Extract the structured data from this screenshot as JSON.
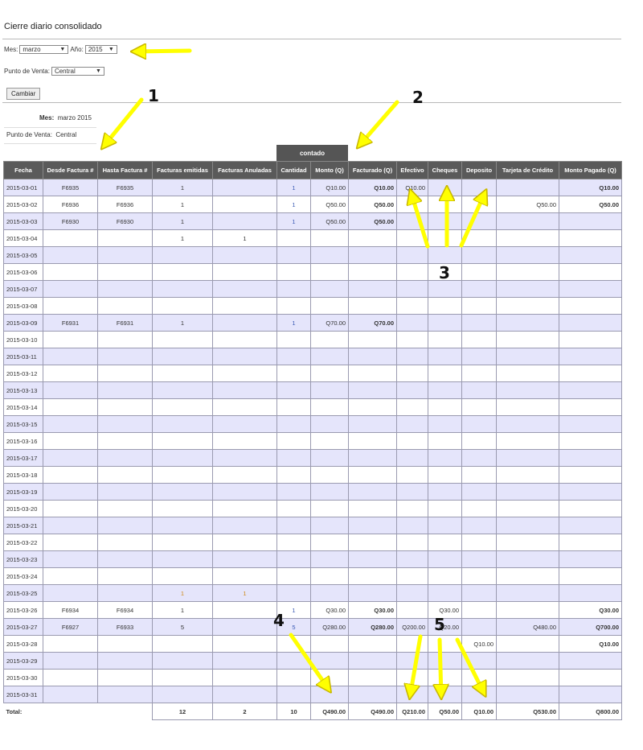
{
  "page": {
    "title": "Cierre diario consolidado"
  },
  "form": {
    "mes_label": "Mes:",
    "mes_value": "marzo",
    "anio_label": "Año:",
    "anio_value": "2015",
    "punto_label": "Punto de Venta:",
    "punto_value": "Central",
    "button_label": "Cambiar"
  },
  "info": {
    "mes_label": "Mes:",
    "mes_value": "marzo 2015",
    "punto_label": "Punto de Venta:",
    "punto_value": "Central"
  },
  "group_header": "contado",
  "columns": [
    "Fecha",
    "Desde Factura #",
    "Hasta Factura #",
    "Facturas emitidas",
    "Facturas Anuladas",
    "Cantidad",
    "Monto (Q)",
    "Facturado (Q)",
    "Efectivo",
    "Cheques",
    "Deposito",
    "Tarjeta de Crédito",
    "Monto Pagado (Q)"
  ],
  "rows": [
    [
      "2015-03-01",
      "F6935",
      "F6935",
      "1",
      "",
      "1",
      "Q10.00",
      "Q10.00",
      "Q10.00",
      "",
      "",
      "",
      "Q10.00"
    ],
    [
      "2015-03-02",
      "F6936",
      "F6936",
      "1",
      "",
      "1",
      "Q50.00",
      "Q50.00",
      "",
      "",
      "",
      "Q50.00",
      "Q50.00"
    ],
    [
      "2015-03-03",
      "F6930",
      "F6930",
      "1",
      "",
      "1",
      "Q50.00",
      "Q50.00",
      "",
      "",
      "",
      "",
      ""
    ],
    [
      "2015-03-04",
      "",
      "",
      "1",
      "1",
      "",
      "",
      "",
      "",
      "",
      "",
      "",
      ""
    ],
    [
      "2015-03-05",
      "",
      "",
      "",
      "",
      "",
      "",
      "",
      "",
      "",
      "",
      "",
      ""
    ],
    [
      "2015-03-06",
      "",
      "",
      "",
      "",
      "",
      "",
      "",
      "",
      "",
      "",
      "",
      ""
    ],
    [
      "2015-03-07",
      "",
      "",
      "",
      "",
      "",
      "",
      "",
      "",
      "",
      "",
      "",
      ""
    ],
    [
      "2015-03-08",
      "",
      "",
      "",
      "",
      "",
      "",
      "",
      "",
      "",
      "",
      "",
      ""
    ],
    [
      "2015-03-09",
      "F6931",
      "F6931",
      "1",
      "",
      "1",
      "Q70.00",
      "Q70.00",
      "",
      "",
      "",
      "",
      ""
    ],
    [
      "2015-03-10",
      "",
      "",
      "",
      "",
      "",
      "",
      "",
      "",
      "",
      "",
      "",
      ""
    ],
    [
      "2015-03-11",
      "",
      "",
      "",
      "",
      "",
      "",
      "",
      "",
      "",
      "",
      "",
      ""
    ],
    [
      "2015-03-12",
      "",
      "",
      "",
      "",
      "",
      "",
      "",
      "",
      "",
      "",
      "",
      ""
    ],
    [
      "2015-03-13",
      "",
      "",
      "",
      "",
      "",
      "",
      "",
      "",
      "",
      "",
      "",
      ""
    ],
    [
      "2015-03-14",
      "",
      "",
      "",
      "",
      "",
      "",
      "",
      "",
      "",
      "",
      "",
      ""
    ],
    [
      "2015-03-15",
      "",
      "",
      "",
      "",
      "",
      "",
      "",
      "",
      "",
      "",
      "",
      ""
    ],
    [
      "2015-03-16",
      "",
      "",
      "",
      "",
      "",
      "",
      "",
      "",
      "",
      "",
      "",
      ""
    ],
    [
      "2015-03-17",
      "",
      "",
      "",
      "",
      "",
      "",
      "",
      "",
      "",
      "",
      "",
      ""
    ],
    [
      "2015-03-18",
      "",
      "",
      "",
      "",
      "",
      "",
      "",
      "",
      "",
      "",
      "",
      ""
    ],
    [
      "2015-03-19",
      "",
      "",
      "",
      "",
      "",
      "",
      "",
      "",
      "",
      "",
      "",
      ""
    ],
    [
      "2015-03-20",
      "",
      "",
      "",
      "",
      "",
      "",
      "",
      "",
      "",
      "",
      "",
      ""
    ],
    [
      "2015-03-21",
      "",
      "",
      "",
      "",
      "",
      "",
      "",
      "",
      "",
      "",
      "",
      ""
    ],
    [
      "2015-03-22",
      "",
      "",
      "",
      "",
      "",
      "",
      "",
      "",
      "",
      "",
      "",
      ""
    ],
    [
      "2015-03-23",
      "",
      "",
      "",
      "",
      "",
      "",
      "",
      "",
      "",
      "",
      "",
      ""
    ],
    [
      "2015-03-24",
      "",
      "",
      "",
      "",
      "",
      "",
      "",
      "",
      "",
      "",
      "",
      ""
    ],
    [
      "2015-03-25",
      "",
      "",
      "1",
      "1",
      "",
      "",
      "",
      "",
      "",
      "",
      "",
      ""
    ],
    [
      "2015-03-26",
      "F6934",
      "F6934",
      "1",
      "",
      "1",
      "Q30.00",
      "Q30.00",
      "",
      "Q30.00",
      "",
      "",
      "Q30.00"
    ],
    [
      "2015-03-27",
      "F6927",
      "F6933",
      "5",
      "",
      "5",
      "Q280.00",
      "Q280.00",
      "Q200.00",
      "Q20.00",
      "",
      "Q480.00",
      "Q700.00"
    ],
    [
      "2015-03-28",
      "",
      "",
      "",
      "",
      "",
      "",
      "",
      "",
      "",
      "Q10.00",
      "",
      "Q10.00"
    ],
    [
      "2015-03-29",
      "",
      "",
      "",
      "",
      "",
      "",
      "",
      "",
      "",
      "",
      "",
      ""
    ],
    [
      "2015-03-30",
      "",
      "",
      "",
      "",
      "",
      "",
      "",
      "",
      "",
      "",
      "",
      ""
    ],
    [
      "2015-03-31",
      "",
      "",
      "",
      "",
      "",
      "",
      "",
      "",
      "",
      "",
      "",
      ""
    ]
  ],
  "totals": {
    "label": "Total:",
    "values": [
      "12",
      "2",
      "10",
      "Q490.00",
      "Q490.00",
      "Q210.00",
      "Q50.00",
      "Q10.00",
      "Q530.00",
      "Q800.00"
    ]
  },
  "annotations": {
    "labels": [
      "1",
      "2",
      "3",
      "4",
      "5"
    ],
    "arrow_color": "#ffff00"
  }
}
